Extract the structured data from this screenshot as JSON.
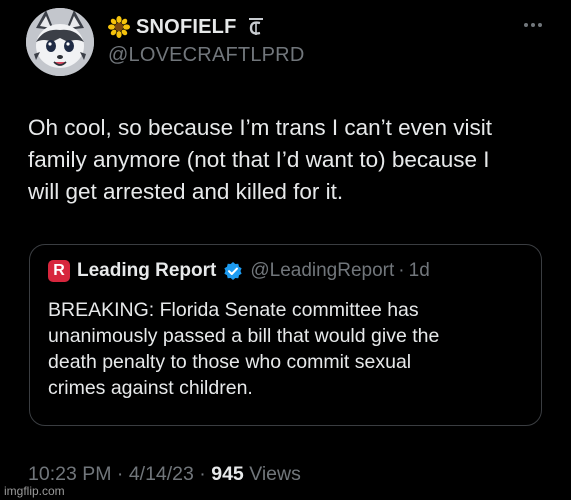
{
  "author": {
    "display_name": "SNOFIELF",
    "handle": "@LOVECRAFTLPRD",
    "avatar_icon": "fox-character-avatar",
    "name_emoji": "sunflower-icon"
  },
  "tweet": {
    "text_lines": [
      "Oh cool, so because I’m trans I can’t even visit",
      "family anymore (not that I’d want to) because I",
      "will get arrested and killed for it."
    ]
  },
  "quote": {
    "logo_letter": "R",
    "logo_color": "#d7263d",
    "name": "Leading Report",
    "handle": "@LeadingReport",
    "separator": "·",
    "time": "1d",
    "verified_color": "#1d9bf0",
    "text_lines": [
      "BREAKING: Florida Senate committee has",
      "unanimously passed a bill that would give the",
      "death penalty to those who commit sexual",
      "crimes against children."
    ]
  },
  "meta": {
    "time": "10:23 PM",
    "separator": "·",
    "date": "4/14/23",
    "views_count": "945",
    "views_label": "Views"
  },
  "watermark": "imgflip.com",
  "colors": {
    "background": "#000000",
    "text_primary": "#e7e9ea",
    "text_secondary": "#71767b",
    "border": "#3a3d41"
  }
}
